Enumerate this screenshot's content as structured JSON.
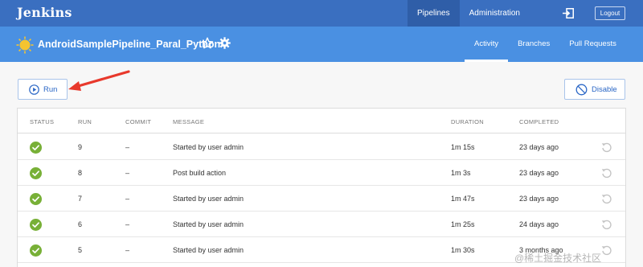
{
  "app": {
    "brand": "Jenkins"
  },
  "topnav": [
    {
      "label": "Pipelines",
      "active": true
    },
    {
      "label": "Administration",
      "active": false
    }
  ],
  "header": {
    "logout_label": "Logout"
  },
  "pipeline": {
    "name": "AndroidSamplePipeline_Paral_Python",
    "tabs": [
      {
        "label": "Activity",
        "active": true
      },
      {
        "label": "Branches",
        "active": false
      },
      {
        "label": "Pull Requests",
        "active": false
      }
    ]
  },
  "actions": {
    "run_label": "Run",
    "disable_label": "Disable"
  },
  "table": {
    "headers": {
      "status": "STATUS",
      "run": "RUN",
      "commit": "COMMIT",
      "message": "MESSAGE",
      "duration": "DURATION",
      "completed": "COMPLETED"
    },
    "rows": [
      {
        "status": "success",
        "run": "9",
        "commit": "–",
        "message": "Started by user admin",
        "duration": "1m 15s",
        "completed": "23 days ago"
      },
      {
        "status": "success",
        "run": "8",
        "commit": "–",
        "message": "Post build action",
        "duration": "1m 3s",
        "completed": "23 days ago"
      },
      {
        "status": "success",
        "run": "7",
        "commit": "–",
        "message": "Started by user admin",
        "duration": "1m 47s",
        "completed": "23 days ago"
      },
      {
        "status": "success",
        "run": "6",
        "commit": "–",
        "message": "Started by user admin",
        "duration": "1m 25s",
        "completed": "24 days ago"
      },
      {
        "status": "success",
        "run": "5",
        "commit": "–",
        "message": "Started by user admin",
        "duration": "1m 30s",
        "completed": "3 months ago"
      }
    ]
  },
  "watermark": "@稀土掘金技术社区",
  "colors": {
    "topbar": "#3a6fc0",
    "subbar": "#4a90e2",
    "link": "#2b67c6",
    "success": "#78b037",
    "arrow": "#e8392c",
    "sun": "#f4c430"
  },
  "icons": {
    "logout": "login-icon",
    "weather": "sun-icon",
    "favorite": "star-icon",
    "settings": "gear-icon",
    "run": "play-circle-icon",
    "disable": "ban-icon",
    "status": "check-circle-icon",
    "replay": "replay-icon"
  }
}
